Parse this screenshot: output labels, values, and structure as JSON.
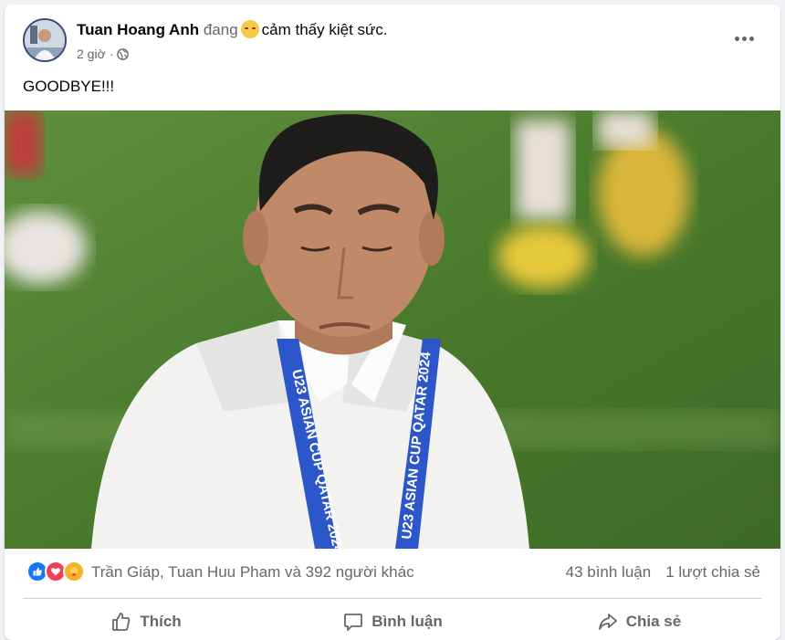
{
  "post": {
    "author": "Tuan Hoang Anh",
    "feeling_prefix": "đang",
    "feeling_text": "cảm thấy kiệt sức.",
    "time": "2 giờ",
    "separator": "·",
    "text": "GOODBYE!!!"
  },
  "photo": {
    "lanyard_text": "U23 ASIAN CUP QATAR 2024"
  },
  "reactions": {
    "icons": [
      "like-icon",
      "love-icon",
      "care-icon"
    ],
    "names": "Trần Giáp, Tuan Huu Pham và 392 người khác",
    "comments": "43 bình luận",
    "shares": "1 lượt chia sẻ"
  },
  "actions": {
    "like": "Thích",
    "comment": "Bình luận",
    "share": "Chia sẻ"
  },
  "colors": {
    "like_blue": "#1877f2",
    "love_red": "#f33e58",
    "care_yellow": "#f7b125",
    "text_secondary": "#65676b",
    "lanyard_blue": "#2c56c9"
  }
}
